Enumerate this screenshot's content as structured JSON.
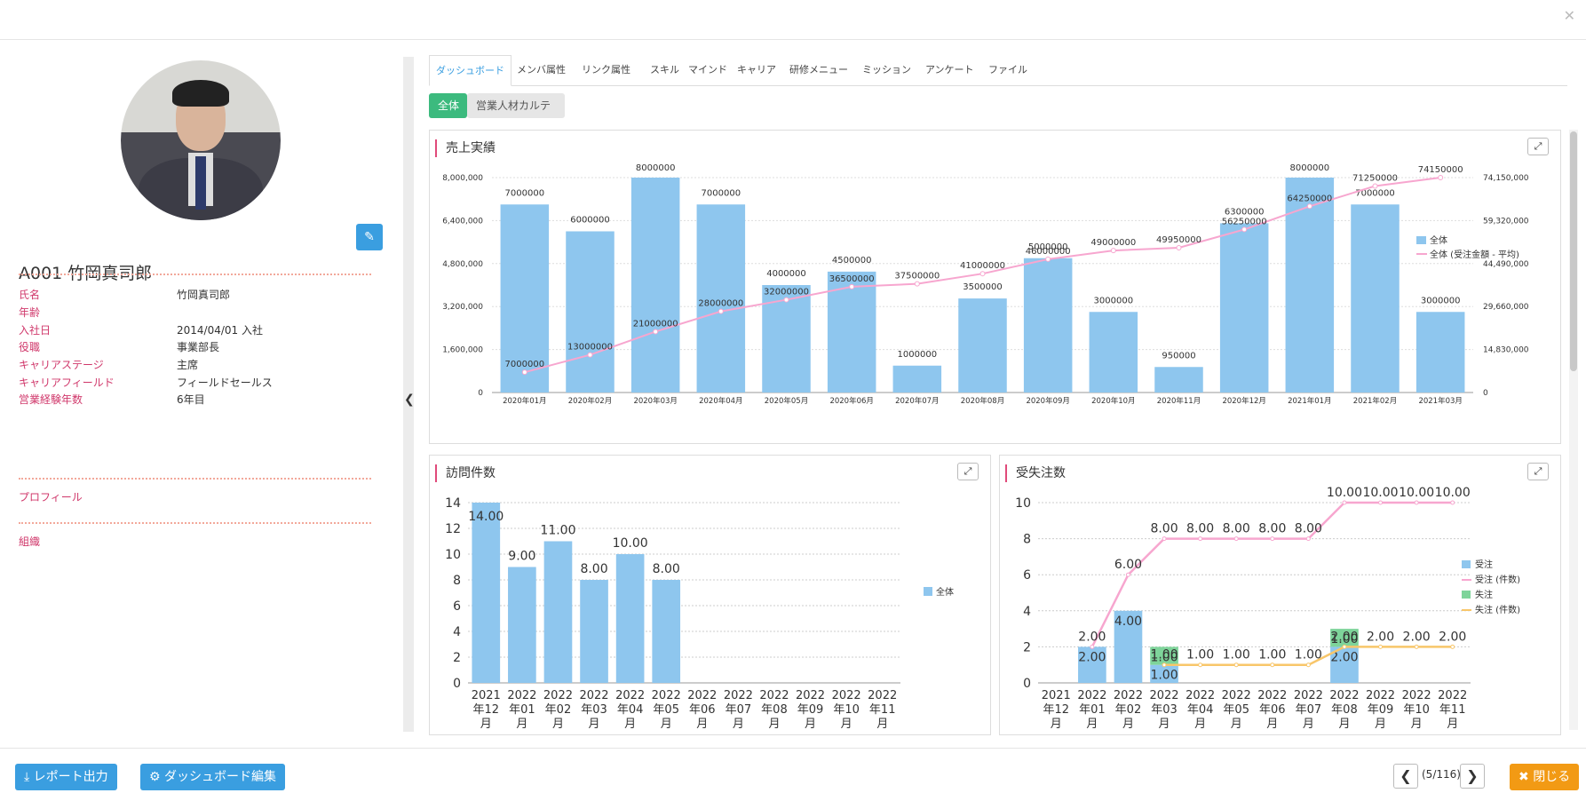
{
  "window": {
    "close_icon": "close-icon"
  },
  "profile": {
    "name_line": "A001  竹岡真司郎",
    "fields": [
      {
        "key": "氏名",
        "value": "竹岡真司郎"
      },
      {
        "key": "年齢",
        "value": ""
      },
      {
        "key": "入社日",
        "value": "2014/04/01 入社"
      },
      {
        "key": "役職",
        "value": "事業部長"
      },
      {
        "key": "キャリアステージ",
        "value": "主席"
      },
      {
        "key": "キャリアフィールド",
        "value": "フィールドセールス"
      },
      {
        "key": "営業経験年数",
        "value": "6年目"
      }
    ],
    "profile_label": "プロフィール",
    "org_label": "組織"
  },
  "tabs": [
    "ダッシュボード",
    "メンバ属性",
    "リンク属性",
    "スキル",
    "マインド",
    "キャリア",
    "研修メニュー",
    "ミッション",
    "アンケート",
    "ファイル"
  ],
  "subtabs": {
    "all": "全体",
    "sales": "営業人材カルテ"
  },
  "panels": {
    "sales": {
      "title": "売上実績"
    },
    "visits": {
      "title": "訪問件数"
    },
    "orders": {
      "title": "受失注数"
    }
  },
  "chart_data": [
    {
      "type": "bar",
      "title": "売上実績",
      "categories": [
        "2020年01月",
        "2020年02月",
        "2020年03月",
        "2020年04月",
        "2020年05月",
        "2020年06月",
        "2020年07月",
        "2020年08月",
        "2020年09月",
        "2020年10月",
        "2020年11月",
        "2020年12月",
        "2021年01月",
        "2021年02月",
        "2021年03月"
      ],
      "series": [
        {
          "name": "全体",
          "type": "bar",
          "axis": "left",
          "values": [
            7000000,
            6000000,
            8000000,
            7000000,
            4000000,
            4500000,
            1000000,
            3500000,
            5000000,
            3000000,
            950000,
            6300000,
            8000000,
            7000000,
            3000000
          ]
        },
        {
          "name": "全体 (受注金額 - 平均)",
          "type": "line",
          "axis": "right",
          "values": [
            7000000,
            13000000,
            21000000,
            28000000,
            32000000,
            36500000,
            37500000,
            41000000,
            46000000,
            49000000,
            49950000,
            56250000,
            64250000,
            71250000,
            74150000
          ]
        }
      ],
      "y_left": {
        "min": 0,
        "max": 8000000,
        "ticks": [
          "0",
          "1,600,000",
          "3,200,000",
          "4,800,000",
          "6,400,000",
          "8,000,000"
        ]
      },
      "y_right": {
        "min": 0,
        "max": 74150000,
        "ticks": [
          "0",
          "14,830,000",
          "29,660,000",
          "44,490,000",
          "59,320,000",
          "74,150,000"
        ]
      },
      "legend": "right",
      "grid": true
    },
    {
      "type": "bar",
      "title": "訪問件数",
      "categories": [
        "2021年12月",
        "2022年01月",
        "2022年02月",
        "2022年03月",
        "2022年04月",
        "2022年05月",
        "2022年06月",
        "2022年07月",
        "2022年08月",
        "2022年09月",
        "2022年10月",
        "2022年11月"
      ],
      "series": [
        {
          "name": "全体",
          "values": [
            14,
            9,
            11,
            8,
            10,
            8,
            null,
            null,
            null,
            null,
            null,
            null
          ],
          "labels": [
            "14.00",
            "9.00",
            "11.00",
            "8.00",
            "10.00",
            "8.00"
          ]
        }
      ],
      "ylim": [
        0,
        14
      ],
      "yticks": [
        "0",
        "2",
        "4",
        "6",
        "8",
        "10",
        "12",
        "14"
      ],
      "legend": "right",
      "grid": true
    },
    {
      "type": "bar",
      "title": "受失注数",
      "categories": [
        "2021年12月",
        "2022年01月",
        "2022年02月",
        "2022年03月",
        "2022年04月",
        "2022年05月",
        "2022年06月",
        "2022年07月",
        "2022年08月",
        "2022年09月",
        "2022年10月",
        "2022年11月"
      ],
      "series": [
        {
          "name": "受注",
          "type": "bar",
          "values": [
            null,
            2,
            4,
            1,
            null,
            null,
            null,
            null,
            2,
            null,
            null,
            null
          ]
        },
        {
          "name": "受注 (件数)",
          "type": "line",
          "values": [
            null,
            2,
            6,
            8,
            8,
            8,
            8,
            8,
            10,
            10,
            10,
            10
          ]
        },
        {
          "name": "失注",
          "type": "bar",
          "values": [
            null,
            null,
            null,
            1,
            null,
            null,
            null,
            null,
            1,
            null,
            null,
            null
          ]
        },
        {
          "name": "失注 (件数)",
          "type": "line",
          "values": [
            null,
            null,
            null,
            1,
            1,
            1,
            1,
            1,
            2,
            2,
            2,
            2
          ]
        }
      ],
      "ylim": [
        0,
        10
      ],
      "yticks": [
        "0",
        "2",
        "4",
        "6",
        "8",
        "10"
      ],
      "legend": "right",
      "grid": true
    }
  ],
  "colors": {
    "bar": "#8ec6ee",
    "line": "#f7a6cf",
    "lost_bar": "#7ed49a",
    "lost_line": "#f8c66a",
    "accent": "#3a9ee0",
    "pink": "#d0386b"
  },
  "footer": {
    "report_label": "レポート出力",
    "edit_label": "ダッシュボード編集",
    "pager": "(5/116)",
    "close_label": "閉じる"
  }
}
